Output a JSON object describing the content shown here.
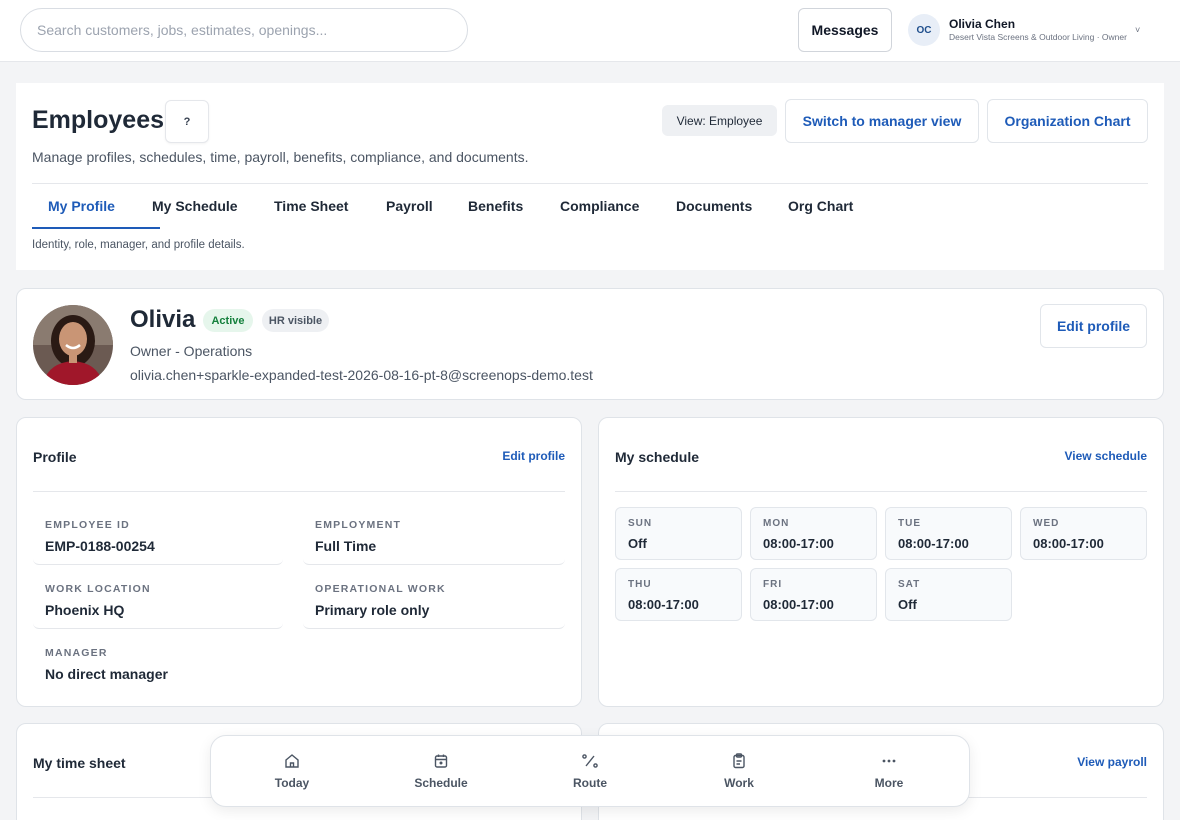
{
  "topbar": {
    "search_placeholder": "Search customers, jobs, estimates, openings...",
    "messages_label": "Messages",
    "user": {
      "initials": "OC",
      "name": "Olivia Chen",
      "org_role": "Desert Vista Screens & Outdoor Living · Owner"
    }
  },
  "header": {
    "title": "Employees",
    "help_label": "?",
    "subtitle": "Manage profiles, schedules, time, payroll, benefits, compliance, and documents.",
    "view_pill": "View: Employee",
    "switch_label": "Switch to manager view",
    "org_chart_label": "Organization Chart",
    "tabs": [
      "My Profile",
      "My Schedule",
      "Time Sheet",
      "Payroll",
      "Benefits",
      "Compliance",
      "Documents",
      "Org Chart"
    ],
    "active_tab": "My Profile",
    "tab_description": "Identity, role, manager, and profile details."
  },
  "profile": {
    "name": "Olivia",
    "status_badge": "Active",
    "visibility_badge": "HR visible",
    "role": "Owner - Operations",
    "email": "olivia.chen+sparkle-expanded-test-2026-08-16-pt-8@screenops-demo.test",
    "edit_label": "Edit profile"
  },
  "profile_card": {
    "title": "Profile",
    "link": "Edit profile",
    "fields": [
      {
        "label": "EMPLOYEE ID",
        "value": "EMP-0188-00254"
      },
      {
        "label": "EMPLOYMENT",
        "value": "Full Time"
      },
      {
        "label": "WORK LOCATION",
        "value": "Phoenix HQ"
      },
      {
        "label": "OPERATIONAL WORK",
        "value": "Primary role only"
      },
      {
        "label": "MANAGER",
        "value": "No direct manager"
      }
    ]
  },
  "schedule_card": {
    "title": "My schedule",
    "link": "View schedule",
    "days": [
      {
        "day": "SUN",
        "hours": "Off"
      },
      {
        "day": "MON",
        "hours": "08:00-17:00"
      },
      {
        "day": "TUE",
        "hours": "08:00-17:00"
      },
      {
        "day": "WED",
        "hours": "08:00-17:00"
      },
      {
        "day": "THU",
        "hours": "08:00-17:00"
      },
      {
        "day": "FRI",
        "hours": "08:00-17:00"
      },
      {
        "day": "SAT",
        "hours": "Off"
      }
    ]
  },
  "timesheet_card": {
    "title": "My time sheet"
  },
  "payroll_card": {
    "link": "View payroll"
  },
  "bottom_nav": [
    {
      "label": "Today",
      "icon": "home-icon"
    },
    {
      "label": "Schedule",
      "icon": "calendar-icon"
    },
    {
      "label": "Route",
      "icon": "route-icon"
    },
    {
      "label": "Work",
      "icon": "clipboard-icon"
    },
    {
      "label": "More",
      "icon": "more-icon"
    }
  ],
  "colors": {
    "accent": "#1e5bb8",
    "active_badge_bg": "#e6f6ec",
    "active_badge_text": "#15803d"
  }
}
